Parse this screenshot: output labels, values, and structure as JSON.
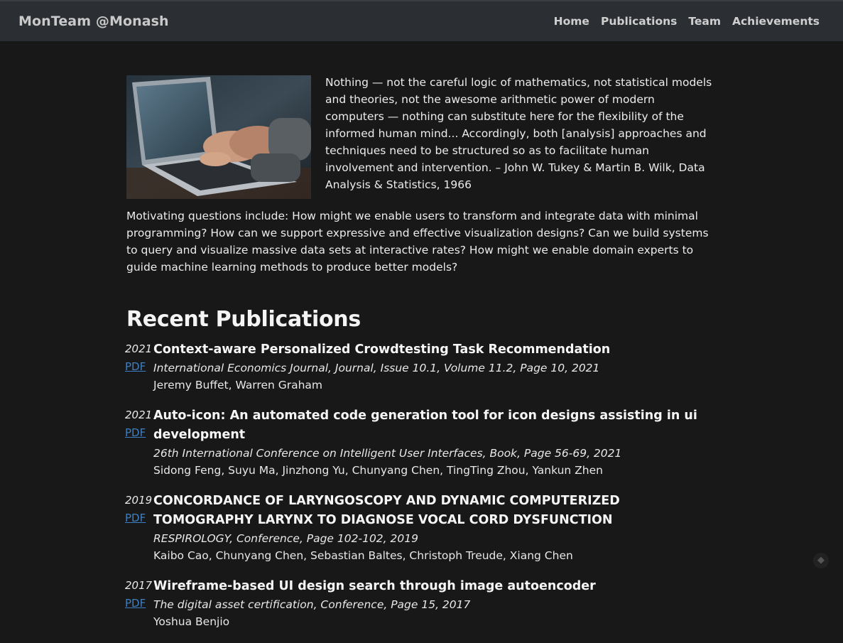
{
  "navbar": {
    "brand": "MonTeam @Monash",
    "links": [
      "Home",
      "Publications",
      "Team",
      "Achievements"
    ]
  },
  "intro": {
    "quote": "Nothing — not the careful logic of mathematics, not statistical models and theories, not the awesome arithmetic power of modern computers — nothing can substitute here for the flexibility of the informed human mind... Accordingly, both [analysis] approaches and techniques need to be structured so as to facilitate human involvement and intervention. – John W. Tukey & Martin B. Wilk, Data Analysis & Statistics, 1966",
    "questions": "Motivating questions include: How might we enable users to transform and integrate data with minimal programming? How can we support expressive and effective visualization designs? Can we build systems to query and visualize massive data sets at interactive rates? How might we enable domain experts to guide machine learning methods to produce better models?"
  },
  "publications": {
    "heading": "Recent Publications",
    "pdf_label": "PDF",
    "items": [
      {
        "year": "2021",
        "title": "Context-aware Personalized Crowdtesting Task Recommendation",
        "venue": "International Economics Journal, Journal, Issue 10.1, Volume 11.2, Page 10, 2021",
        "authors": "Jeremy Buffet, Warren Graham"
      },
      {
        "year": "2021",
        "title": "Auto-icon: An automated code generation tool for icon designs assisting in ui development",
        "venue": "26th International Conference on Intelligent User Interfaces, Book, Page 56-69, 2021",
        "authors": "Sidong Feng, Suyu Ma, Jinzhong Yu, Chunyang Chen, TingTing Zhou, Yankun Zhen"
      },
      {
        "year": "2019",
        "title": "CONCORDANCE OF LARYNGOSCOPY AND DYNAMIC COMPUTERIZED TOMOGRAPHY LARYNX TO DIAGNOSE VOCAL CORD DYSFUNCTION",
        "venue": "RESPIROLOGY, Conference, Page 102-102, 2019",
        "authors": "Kaibo Cao, Chunyang Chen, Sebastian Baltes, Christoph Treude, Xiang Chen"
      },
      {
        "year": "2017",
        "title": "Wireframe-based UI design search through image autoencoder",
        "venue": "The digital asset certification, Conference, Page 15, 2017",
        "authors": "Yoshua Benjio"
      }
    ]
  }
}
